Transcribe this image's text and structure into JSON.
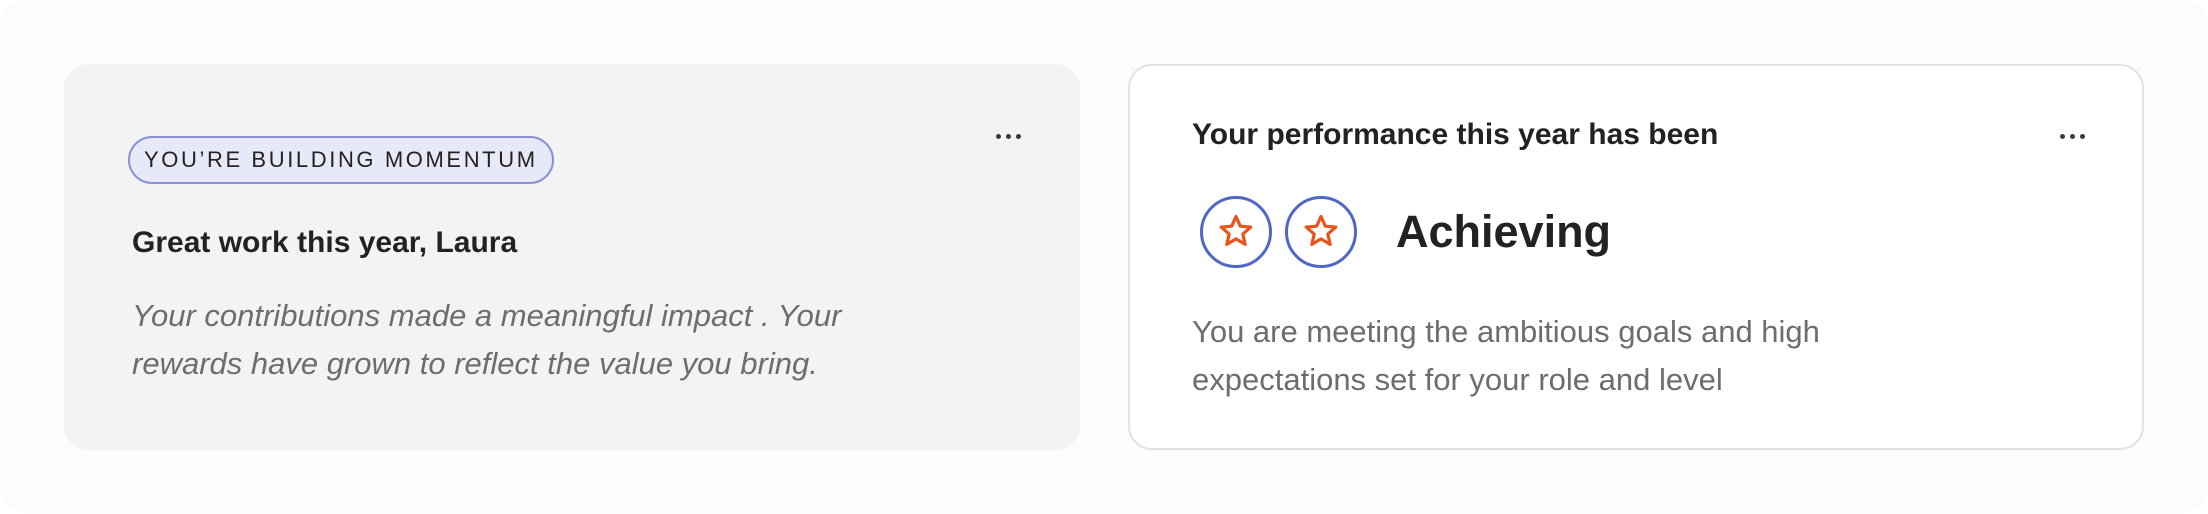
{
  "momentum_card": {
    "badge": "YOU’RE BUILDING MOMENTUM",
    "title": "Great work this year, Laura",
    "body": "Your contributions made a meaningful impact . Your rewards have grown to reflect the value you bring.",
    "more_icon": "more-horizontal-icon"
  },
  "performance_card": {
    "title": "Your performance this year has been",
    "rating_label": "Achieving",
    "rating_stars": 2,
    "star_icon": "star-icon",
    "body": "You are meeting the ambitious goals and high expectations set for your role and level",
    "more_icon": "more-horizontal-icon"
  },
  "colors": {
    "badge_border": "#8891d4",
    "badge_background": "#e7e9f8",
    "star_ring": "#4f68c8",
    "star": "#e9541b",
    "left_card_background": "#f3f3f4",
    "right_card_border": "#e2e2e5"
  }
}
